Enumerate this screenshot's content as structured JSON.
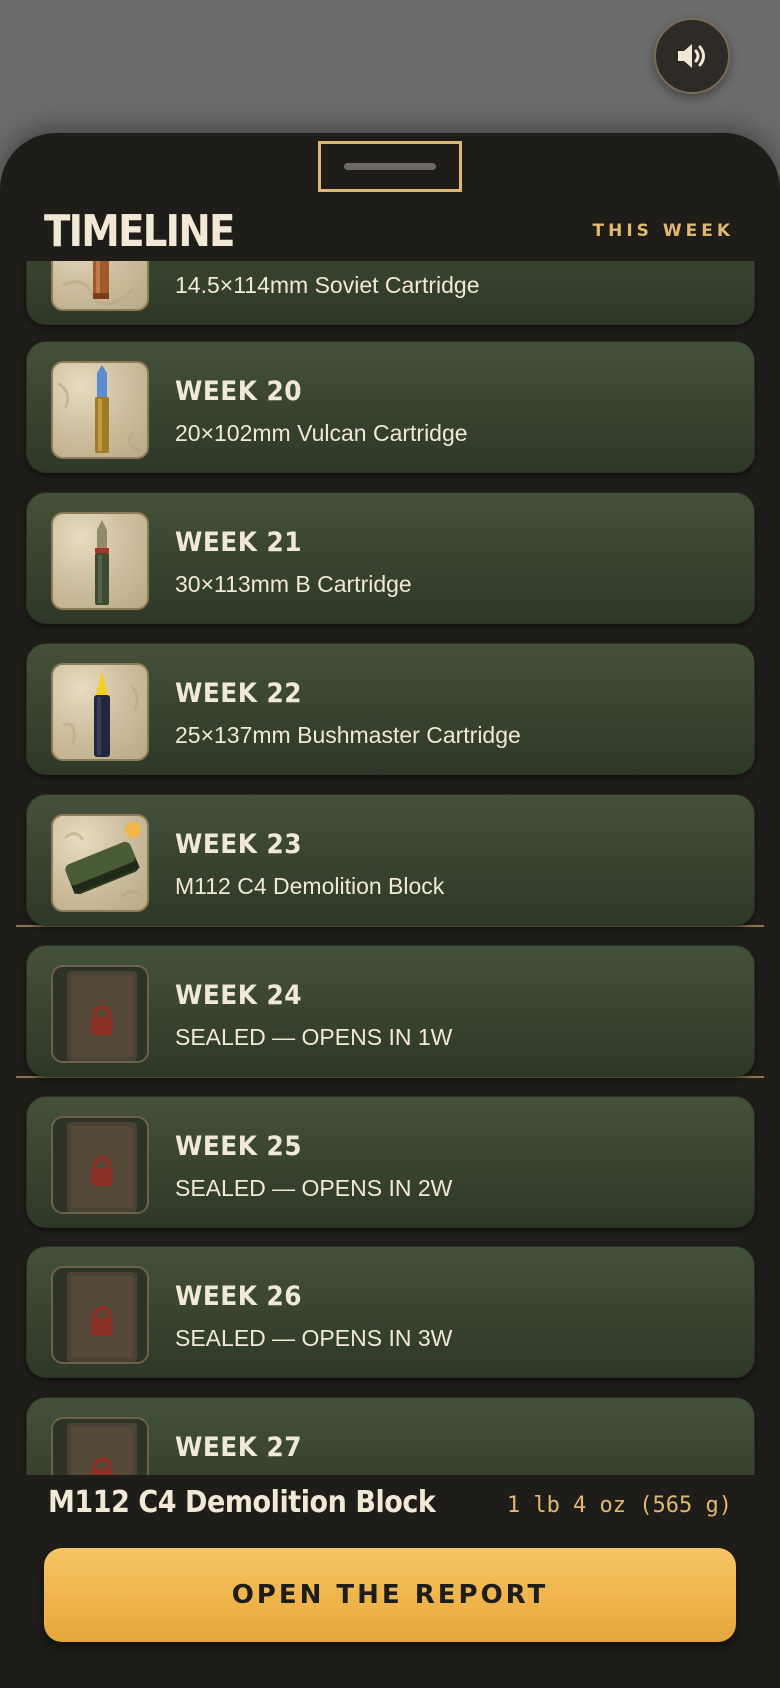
{
  "sound_button": {
    "icon": "speaker-icon"
  },
  "header": {
    "title": "TIMELINE",
    "this_week": "THIS WEEK"
  },
  "items": [
    {
      "week": "",
      "name": "14.5×114mm Soviet Cartridge",
      "icon": "cartridge-copper-icon"
    },
    {
      "week": "WEEK 20",
      "name": "20×102mm Vulcan Cartridge",
      "icon": "cartridge-blue-tip-icon"
    },
    {
      "week": "WEEK 21",
      "name": "30×113mm B Cartridge",
      "icon": "cartridge-red-band-icon"
    },
    {
      "week": "WEEK 22",
      "name": "25×137mm Bushmaster Cartridge",
      "icon": "cartridge-yellow-tip-icon"
    },
    {
      "week": "WEEK 23",
      "name": "M112 C4 Demolition Block",
      "icon": "c4-demo-charge-icon",
      "current": true
    },
    {
      "week": "WEEK 24",
      "name": "SEALED — OPENS IN 1W",
      "icon": "sealed-secret-folder-icon"
    },
    {
      "week": "WEEK 25",
      "name": "SEALED — OPENS IN 2W",
      "icon": "sealed-secret-folder-icon"
    },
    {
      "week": "WEEK 26",
      "name": "SEALED — OPENS IN 3W",
      "icon": "sealed-secret-folder-icon"
    },
    {
      "week": "WEEK 27",
      "name": "",
      "icon": "sealed-secret-folder-icon"
    }
  ],
  "footer": {
    "selected_name": "M112 C4 Demolition Block",
    "selected_weight": "1 lb 4 oz (565 g)",
    "cta_label": "OPEN THE REPORT"
  },
  "colors": {
    "accent": "#e0b872",
    "card": "#3d4934",
    "cta": "#f0b74f",
    "sheet": "#1f1d1a"
  }
}
